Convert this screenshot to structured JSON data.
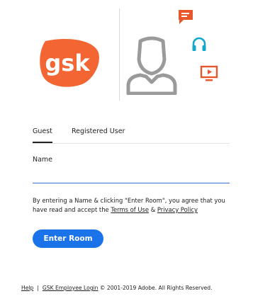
{
  "brand": {
    "logo_text": "gsk",
    "colors": {
      "logo_orange": "#f36633",
      "accent_orange": "#e8572b",
      "accent_teal": "#13a8c9",
      "icon_gray": "#9a9a9a",
      "primary_blue": "#1a73e8"
    }
  },
  "hero_icons": [
    "chat-bubble-icon",
    "headset-icon",
    "presentation-screen-icon",
    "host-avatar-icon"
  ],
  "tabs": [
    {
      "label": "Guest",
      "selected": true
    },
    {
      "label": "Registered User",
      "selected": false
    }
  ],
  "form": {
    "name_label": "Name",
    "name_value": "",
    "name_placeholder": ""
  },
  "consent": {
    "prefix": "By entering a Name & clicking \"Enter Room\", you agree that you have read and accept the ",
    "terms_link": "Terms of Use",
    "joiner": " & ",
    "privacy_link": "Privacy Policy"
  },
  "enter_button": "Enter Room",
  "footer": {
    "help_link": "Help",
    "separator": "|",
    "employee_login_link": "GSK Employee Login",
    "copyright": " © 2001-2019 Adobe. All Rights Reserved."
  }
}
